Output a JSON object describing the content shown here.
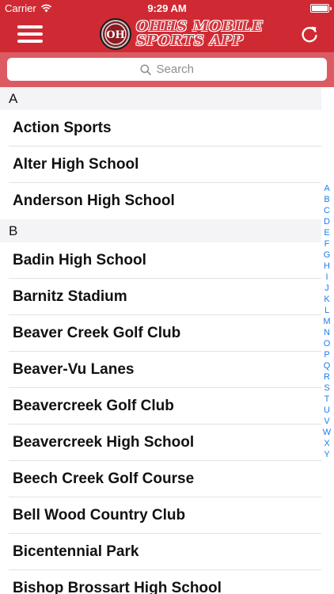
{
  "status_bar": {
    "carrier": "Carrier",
    "time": "9:29 AM"
  },
  "app": {
    "title_line1": "OHHS MOBILE",
    "title_line2": "SPORTS APP",
    "logo_text": "OH"
  },
  "colors": {
    "brand_red": "#cf2a33",
    "search_bg": "#dc5b62",
    "index_blue": "#1e7cf0"
  },
  "icons": {
    "menu": "hamburger-menu-icon",
    "refresh": "refresh-icon",
    "search": "search-icon",
    "wifi": "wifi-icon",
    "battery": "battery-icon"
  },
  "search": {
    "placeholder": "Search"
  },
  "sections": [
    {
      "header": "A",
      "items": [
        "Action Sports",
        "Alter High School",
        "Anderson High School"
      ]
    },
    {
      "header": "B",
      "items": [
        "Badin High School",
        "Barnitz Stadium",
        "Beaver Creek Golf Club",
        "Beaver-Vu Lanes",
        "Beavercreek Golf Club",
        "Beavercreek High School",
        "Beech Creek Golf Course",
        "Bell Wood Country Club",
        "Bicentennial Park",
        "Bishop Brossart High School"
      ]
    }
  ],
  "index_letters": [
    "A",
    "B",
    "C",
    "D",
    "E",
    "F",
    "G",
    "H",
    "I",
    "J",
    "K",
    "L",
    "M",
    "N",
    "O",
    "P",
    "Q",
    "R",
    "S",
    "T",
    "U",
    "V",
    "W",
    "X",
    "Y"
  ]
}
